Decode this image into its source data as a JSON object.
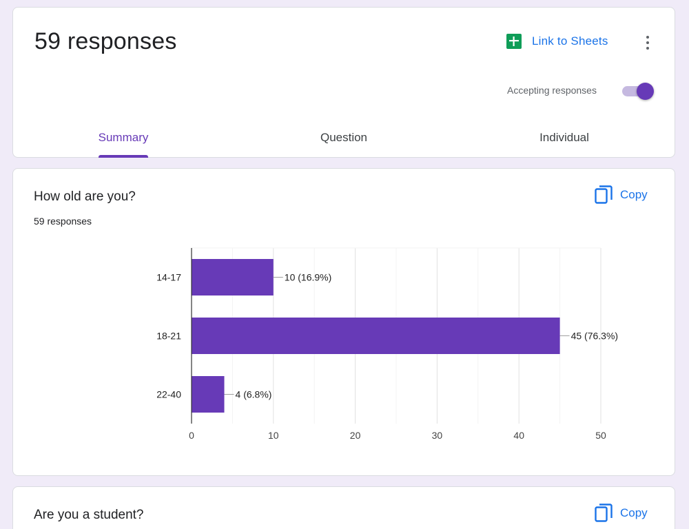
{
  "header": {
    "title": "59 responses",
    "sheets_link_label": "Link to Sheets",
    "accepting_label": "Accepting responses",
    "accepting": true,
    "tabs": [
      {
        "label": "Summary",
        "active": true
      },
      {
        "label": "Question",
        "active": false
      },
      {
        "label": "Individual",
        "active": false
      }
    ]
  },
  "questions": [
    {
      "title": "How old are you?",
      "count_label": "59 responses",
      "copy_label": "Copy"
    },
    {
      "title": "Are you a student?",
      "copy_label": "Copy"
    }
  ],
  "colors": {
    "accent": "#673ab7",
    "link": "#1a73e8",
    "sheets_green": "#0f9d58",
    "background": "#f0ebf8"
  },
  "chart_data": {
    "type": "bar",
    "orientation": "horizontal",
    "categories": [
      "14-17",
      "18-21",
      "22-40"
    ],
    "values": [
      10,
      45,
      4
    ],
    "data_labels": [
      "10 (16.9%)",
      "45 (76.3%)",
      "4 (6.8%)"
    ],
    "xlim": [
      0,
      50
    ],
    "x_ticks": [
      "0",
      "10",
      "20",
      "30",
      "40",
      "50"
    ],
    "grid": true,
    "color": "#673ab7"
  }
}
